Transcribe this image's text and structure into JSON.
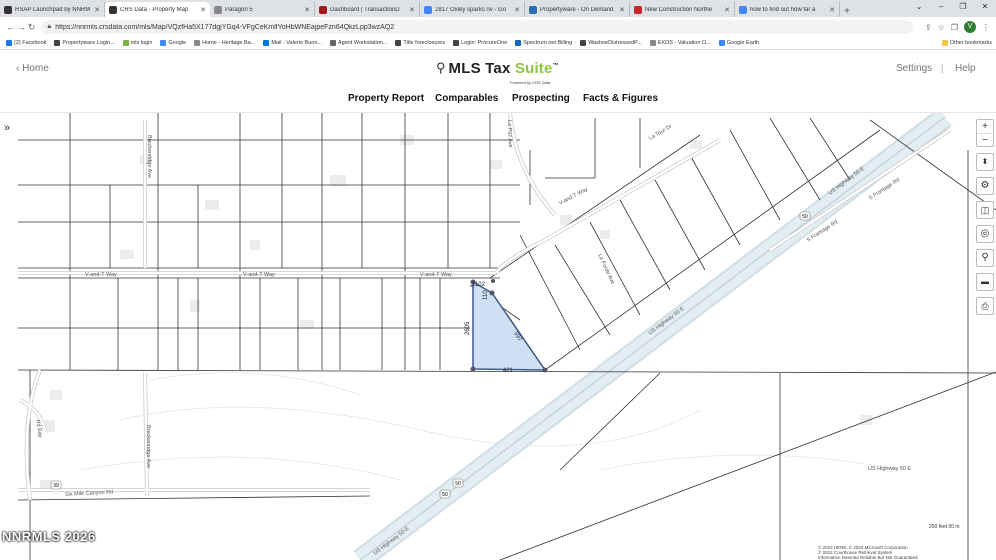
{
  "browser": {
    "tabs": [
      {
        "title": "RSAP Launchpad by NNRM",
        "color": "#333333"
      },
      {
        "title": "CRS Data - Property Map",
        "color": "#333333",
        "active": true
      },
      {
        "title": "Paragon 5",
        "color": "#888888"
      },
      {
        "title": "Dashboard | TransactionD",
        "color": "#a01c1c"
      },
      {
        "title": "2817 Oxley sparks nv - Go",
        "color": "#4285f4"
      },
      {
        "title": "Propertyware - On Demand",
        "color": "#2a6fb5"
      },
      {
        "title": "New Construction Northe",
        "color": "#c62828"
      },
      {
        "title": "how to find out how far a",
        "color": "#4285f4"
      }
    ],
    "url": "https://nnrmls.crsdata.com/mls/Map/VQzfHa5X177dgjYGq4-VFgCeKmlfYoHbWNEajpeFzn64QkzLpp3wzAQ2",
    "avatar": "V",
    "bookmarks": [
      {
        "label": "(2) Facebook",
        "color": "#1877f2"
      },
      {
        "label": "Propertyware Login...",
        "color": "#444444"
      },
      {
        "label": "mls login",
        "color": "#7cb342"
      },
      {
        "label": "Google",
        "color": "#4285f4"
      },
      {
        "label": "Home - Heritage Ba...",
        "color": "#888888"
      },
      {
        "label": "Mail - Valerie Buon...",
        "color": "#0078d4"
      },
      {
        "label": "Agent Workstation...",
        "color": "#666666"
      },
      {
        "label": "Title foreclosures",
        "color": "#444444"
      },
      {
        "label": "Login: ProcureOne",
        "color": "#444444"
      },
      {
        "label": "Spectrum.net Billing",
        "color": "#1565c0"
      },
      {
        "label": "WashoeDistressedP...",
        "color": "#444444"
      },
      {
        "label": "EXOS - Valuation O...",
        "color": "#888888"
      },
      {
        "label": "Google Earth",
        "color": "#4285f4"
      }
    ],
    "other_bookmarks": "Other bookmarks"
  },
  "app": {
    "home": "‹ Home",
    "logo_text": "MLS Tax ",
    "logo_suite": "Suite",
    "logo_tm": "™",
    "logo_sub": "Powered by CRS Data",
    "settings": "Settings",
    "separator": "|",
    "help": "Help",
    "menu": [
      "Property Report",
      "Comparables",
      "Prospecting",
      "Facts & Figures"
    ]
  },
  "map": {
    "road_labels": {
      "v_and_t_way_1": "V-and-T Way",
      "v_and_t_way_2": "V-and-T Way",
      "v_and_t_way_3": "V-and-T Way",
      "v_and_t_way_4": "V-and-T Way",
      "us_hwy_50_1": "US Highway 50 E",
      "us_hwy_50_2": "US Highway 50 E",
      "us_hwy_50_3": "US Highway 50 E",
      "us_hwy_50_4": "US Highway 50 E",
      "frontage_1": "S Frontage Rd",
      "frontage_2": "S Frontage Rd",
      "six_mile": "Six Mile Canyon Rd",
      "breckenridge_1": "Breckenridge Ave",
      "breckenridge_2": "Breckenridge Ave",
      "la_paz": "La Paz Ave",
      "le_forde": "Le Forde Ave",
      "la_tour": "La Tour Dr",
      "rd_left": "Rd Bay",
      "shield_50_a": "50",
      "shield_50_b": "50",
      "shield_50_c": "50",
      "shield_39": "39"
    },
    "parcel_dims": {
      "top": "1102",
      "left": "2605",
      "bottom": "421",
      "diag": "597",
      "right_top": "110"
    },
    "watermark": "NNRMLS 2026",
    "scale": "250 feet        50 m",
    "attribution_1": "© 2022 HERE, © 2022 Microsoft Corporation",
    "attribution_2": "© 2022 Courthouse Retrieval System",
    "attribution_3": "Information Deemed Reliable But Not Guaranteed"
  },
  "colors": {
    "parcel_fill": "#cfe0f5",
    "parcel_stroke": "#3d5a8a",
    "highway": "#d9e8ef",
    "suite_green": "#8dc63f"
  },
  "icons": [
    "expand-arrows-icon",
    "zoom-in-icon",
    "zoom-out-icon",
    "compass-icon",
    "gear-icon",
    "layers-icon",
    "locate-icon",
    "search-icon",
    "measure-icon",
    "print-icon"
  ]
}
